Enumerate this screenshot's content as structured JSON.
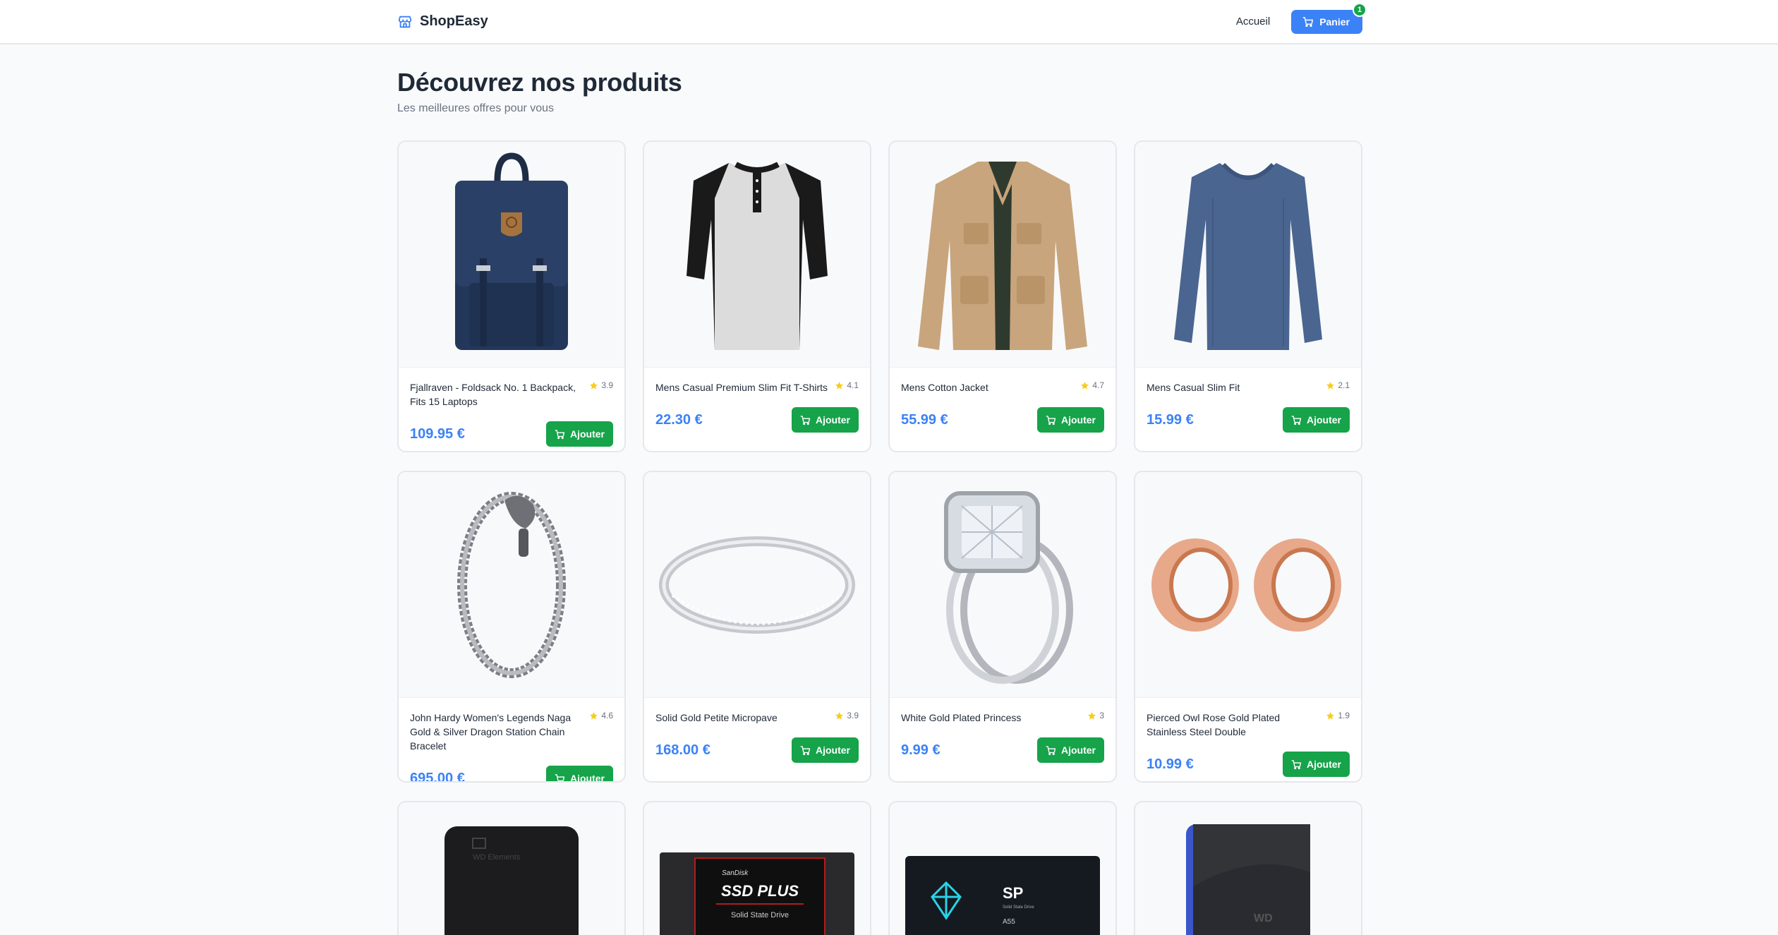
{
  "header": {
    "brand": "ShopEasy",
    "brand_icon": "store-icon",
    "nav_home": "Accueil",
    "cart_label": "Panier",
    "cart_icon": "cart-icon",
    "cart_count": "1"
  },
  "hero": {
    "title": "Découvrez nos produits",
    "subtitle": "Les meilleures offres pour vous"
  },
  "colors": {
    "accent": "#3b82f6",
    "add_button": "#16a34a",
    "star": "#facc15",
    "background": "#f9fafb"
  },
  "add_label": "Ajouter",
  "products": [
    {
      "title": "Fjallraven - Foldsack No. 1 Backpack, Fits 15 Laptops",
      "rating": "3.9",
      "price": "109.95 €",
      "image": "backpack"
    },
    {
      "title": "Mens Casual Premium Slim Fit T-Shirts",
      "rating": "4.1",
      "price": "22.30 €",
      "image": "raglan-tshirt"
    },
    {
      "title": "Mens Cotton Jacket",
      "rating": "4.7",
      "price": "55.99 €",
      "image": "cotton-jacket"
    },
    {
      "title": "Mens Casual Slim Fit",
      "rating": "2.1",
      "price": "15.99 €",
      "image": "long-sleeve-shirt"
    },
    {
      "title": "John Hardy Women's Legends Naga Gold & Silver Dragon Station Chain Bracelet",
      "rating": "4.6",
      "price": "695.00 €",
      "image": "dragon-bracelet"
    },
    {
      "title": "Solid Gold Petite Micropave",
      "rating": "3.9",
      "price": "168.00 €",
      "image": "micropave-ring"
    },
    {
      "title": "White Gold Plated Princess",
      "rating": "3",
      "price": "9.99 €",
      "image": "princess-ring"
    },
    {
      "title": "Pierced Owl Rose Gold Plated Stainless Steel Double",
      "rating": "1.9",
      "price": "10.99 €",
      "image": "rose-gold-tunnels"
    }
  ],
  "partial_products": [
    {
      "image": "external-hard-drive",
      "brand_text": "WD Elements"
    },
    {
      "image": "ssd-sandisk",
      "brand_text": "SanDisk",
      "model_text": "SSD PLUS",
      "sub_text": "Solid State Drive"
    },
    {
      "image": "ssd-silicon-power",
      "brand_text": "SP",
      "sub_text": "Solid State Drive",
      "model_text": "A55"
    },
    {
      "image": "gaming-drive",
      "brand_text": "WD"
    }
  ]
}
